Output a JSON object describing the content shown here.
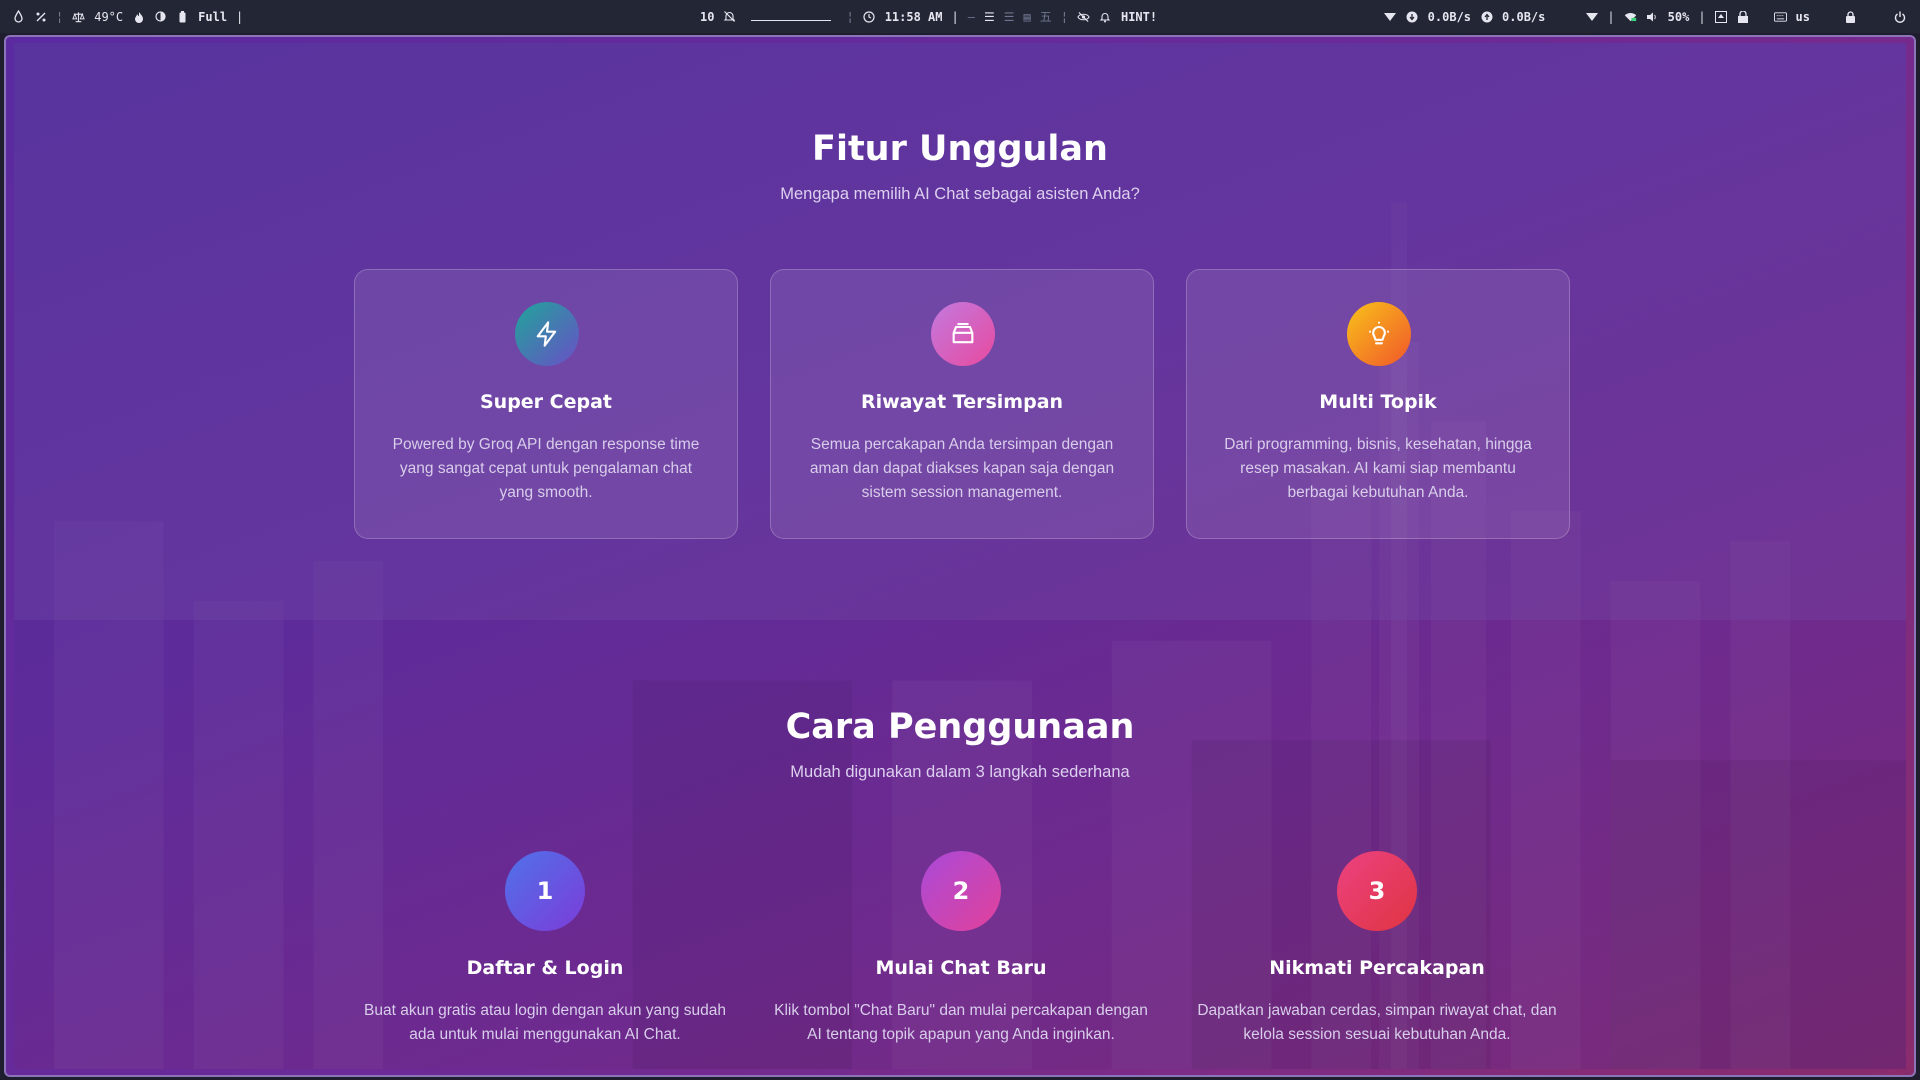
{
  "topbar": {
    "left": {
      "temp": "49°C",
      "mode": "Full"
    },
    "center": {
      "workspace": "10",
      "time": "11:58 AM",
      "hint": "HINT!"
    },
    "right": {
      "net_down": "0.0B/s",
      "net_up": "0.0B/s",
      "volume": "50%",
      "keyboard": "us"
    }
  },
  "features": {
    "title": "Fitur Unggulan",
    "subtitle": "Mengapa memilih AI Chat sebagai asisten Anda?",
    "cards": [
      {
        "icon": "lightning-icon",
        "title": "Super Cepat",
        "desc": "Powered by Groq API dengan response time yang sangat cepat untuk pengalaman chat yang smooth.",
        "gradient": [
          "#1f9d9a",
          "#6a4fc7"
        ]
      },
      {
        "icon": "archive-icon",
        "title": "Riwayat Tersimpan",
        "desc": "Semua percakapan Anda tersimpan dengan aman dan dapat diakses kapan saja dengan sistem session management.",
        "gradient": [
          "#c06ad9",
          "#e04aa0"
        ]
      },
      {
        "icon": "lightbulb-icon",
        "title": "Multi Topik",
        "desc": "Dari programming, bisnis, kesehatan, hingga resep masakan. AI kami siap membantu berbagai kebutuhan Anda.",
        "gradient": [
          "#f7b21b",
          "#f05a28"
        ]
      }
    ]
  },
  "steps": {
    "title": "Cara Penggunaan",
    "subtitle": "Mudah digunakan dalam 3 langkah sederhana",
    "items": [
      {
        "number": "1",
        "title": "Daftar & Login",
        "desc": "Buat akun gratis atau login dengan akun yang sudah ada untuk mulai menggunakan AI Chat.",
        "gradient": [
          "#4f6fe6",
          "#7a3ed6"
        ]
      },
      {
        "number": "2",
        "title": "Mulai Chat Baru",
        "desc": "Klik tombol \"Chat Baru\" dan mulai percakapan dengan AI tentang topik apapun yang Anda inginkan.",
        "gradient": [
          "#b44ad8",
          "#e0439a"
        ]
      },
      {
        "number": "3",
        "title": "Nikmati Percakapan",
        "desc": "Dapatkan jawaban cerdas, simpan riwayat chat, dan kelola session sesuai kebutuhan Anda.",
        "gradient": [
          "#ea3f7a",
          "#e0343e"
        ]
      }
    ]
  }
}
